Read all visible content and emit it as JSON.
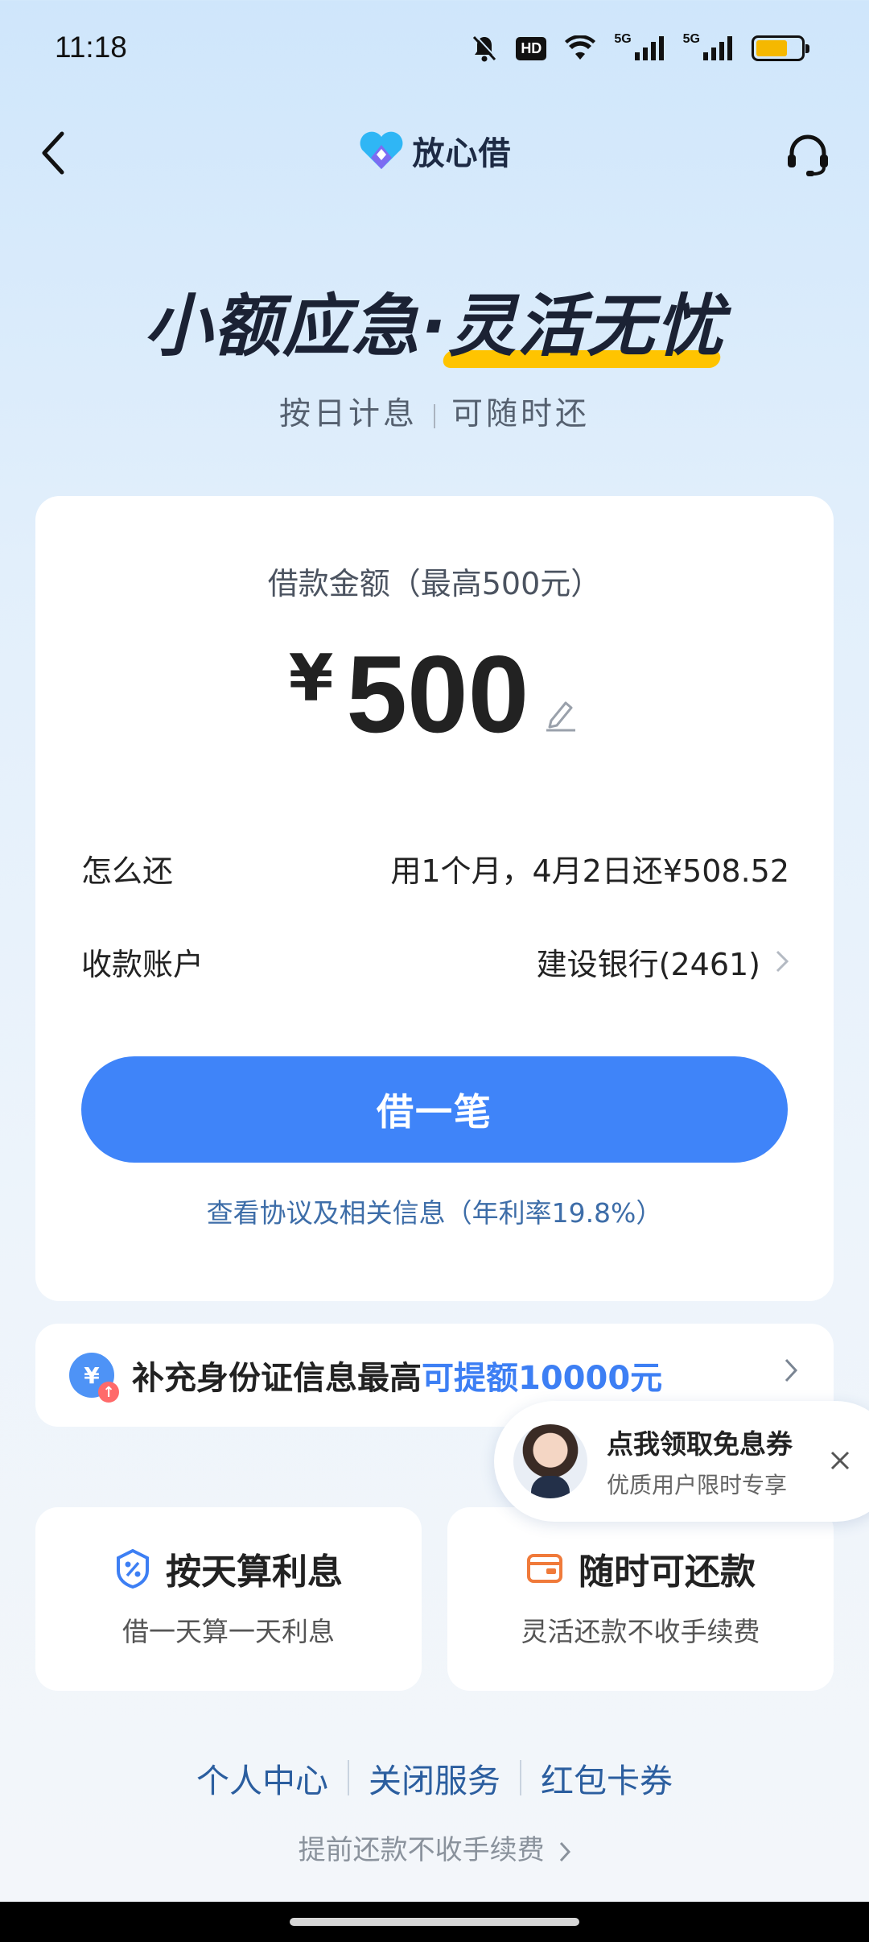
{
  "status_bar": {
    "time": "11:18",
    "network_label_1": "5G",
    "network_label_2": "5G",
    "hd_label": "HD",
    "icons": [
      "mute-bell-icon",
      "hd-voice-icon",
      "wifi-icon",
      "signal-icon",
      "signal-icon",
      "battery-icon"
    ],
    "battery_level": 0.7
  },
  "nav": {
    "brand_name": "放心借",
    "icons": [
      "back-arrow-icon",
      "brand-logo-icon",
      "headset-icon"
    ]
  },
  "hero": {
    "slogan_part1": "小额应急·",
    "slogan_part2": "灵活无忧",
    "subtitle_left": "按日计息",
    "subtitle_right": "可随时还"
  },
  "loan": {
    "amount_label": "借款金额（最高500元）",
    "currency": "¥",
    "amount": "500",
    "repay_label": "怎么还",
    "repay_value": "用1个月，4月2日还¥508.52",
    "account_label": "收款账户",
    "account_value": "建设银行(2461)",
    "borrow_button": "借一笔",
    "agreement_text": "查看协议及相关信息（年利率19.8%）"
  },
  "promo": {
    "text_prefix": "补充身份证信息最高",
    "text_highlight": "可提额10000元",
    "icon_symbol": "¥",
    "accent_color": "#3d7ff4"
  },
  "coupon": {
    "title": "点我领取免息券",
    "subtitle": "优质用户限时专享"
  },
  "features": [
    {
      "title": "按天算利息",
      "desc": "借一天算一天利息",
      "icon": "percent-shield-icon",
      "color": "#3d7ff4"
    },
    {
      "title": "随时可还款",
      "desc": "灵活还款不收手续费",
      "icon": "wallet-icon",
      "color": "#f07a3a"
    }
  ],
  "footer": {
    "links": [
      "个人中心",
      "关闭服务",
      "红包卡券"
    ],
    "prepay_text": "提前还款不收手续费"
  },
  "colors": {
    "primary": "#3f84f9",
    "highlight": "#ffc400"
  }
}
